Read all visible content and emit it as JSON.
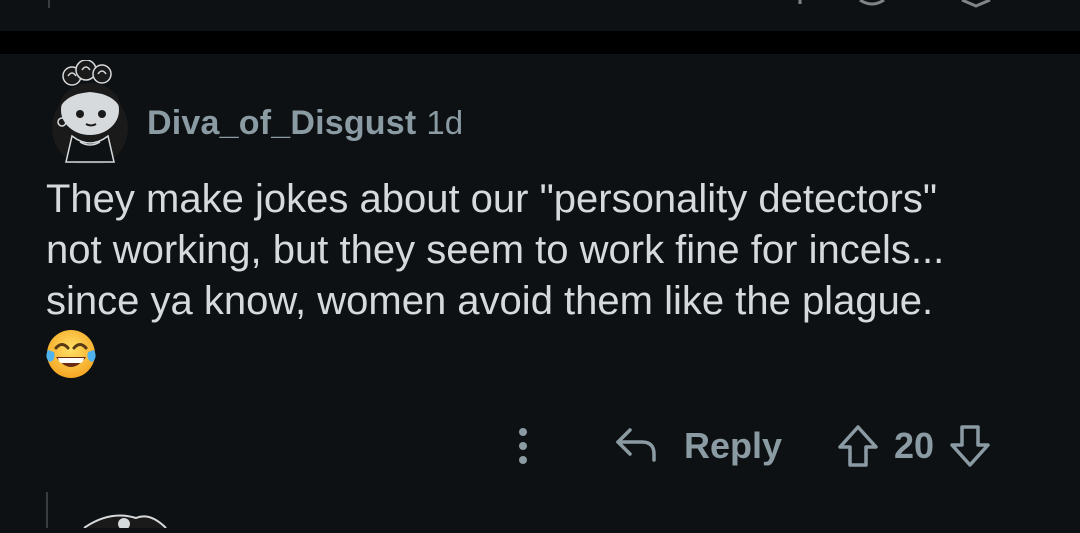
{
  "comment": {
    "username": "Diva_of_Disgust",
    "timestamp": "1d",
    "body_lines": [
      "They make jokes about our \"personality detectors\"",
      "not working, but they seem to work fine for incels...",
      "since ya know, women avoid them like the plague."
    ],
    "emoji": "face-with-tears-of-joy",
    "actions": {
      "more_icon": "vertical-dots-icon",
      "reply_label": "Reply",
      "reply_icon": "reply-arrow-icon",
      "upvote_icon": "upvote-arrow-icon",
      "score": "20",
      "downvote_icon": "downvote-arrow-icon"
    }
  },
  "colors": {
    "background": "#0e1113",
    "separator": "#000000",
    "text_primary": "#d7dadc",
    "text_muted": "#8b9ba3",
    "thread_line": "#3a3d40"
  }
}
